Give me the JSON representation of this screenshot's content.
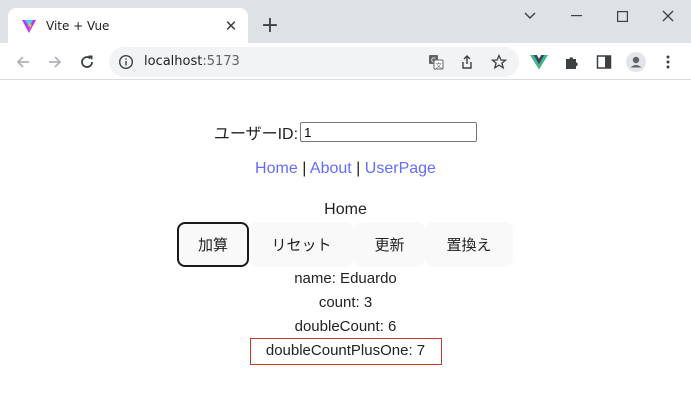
{
  "browser": {
    "tab_title": "Vite + Vue",
    "url_host": "localhost",
    "url_port": ":5173",
    "colors": {
      "vue_green": "#41b883",
      "vue_dark": "#35495e",
      "vite_purple": "#bd34fe",
      "vite_yellow": "#ffc517"
    }
  },
  "page": {
    "user_id_label": "ユーザーID:",
    "user_id_value": "1",
    "nav": {
      "home": "Home",
      "sep1": "|",
      "about": "About",
      "sep2": "|",
      "userpage": "UserPage"
    },
    "view_title": "Home",
    "buttons": {
      "add": "加算",
      "reset": "リセット",
      "update": "更新",
      "replace": "置換え"
    },
    "info": {
      "name": "name: Eduardo",
      "count": "count: 3",
      "double_count": "doubleCount: 6",
      "double_count_plus_one": "doubleCountPlusOne: 7"
    },
    "link_color": "#646cff",
    "highlight_color": "#c0392b"
  }
}
